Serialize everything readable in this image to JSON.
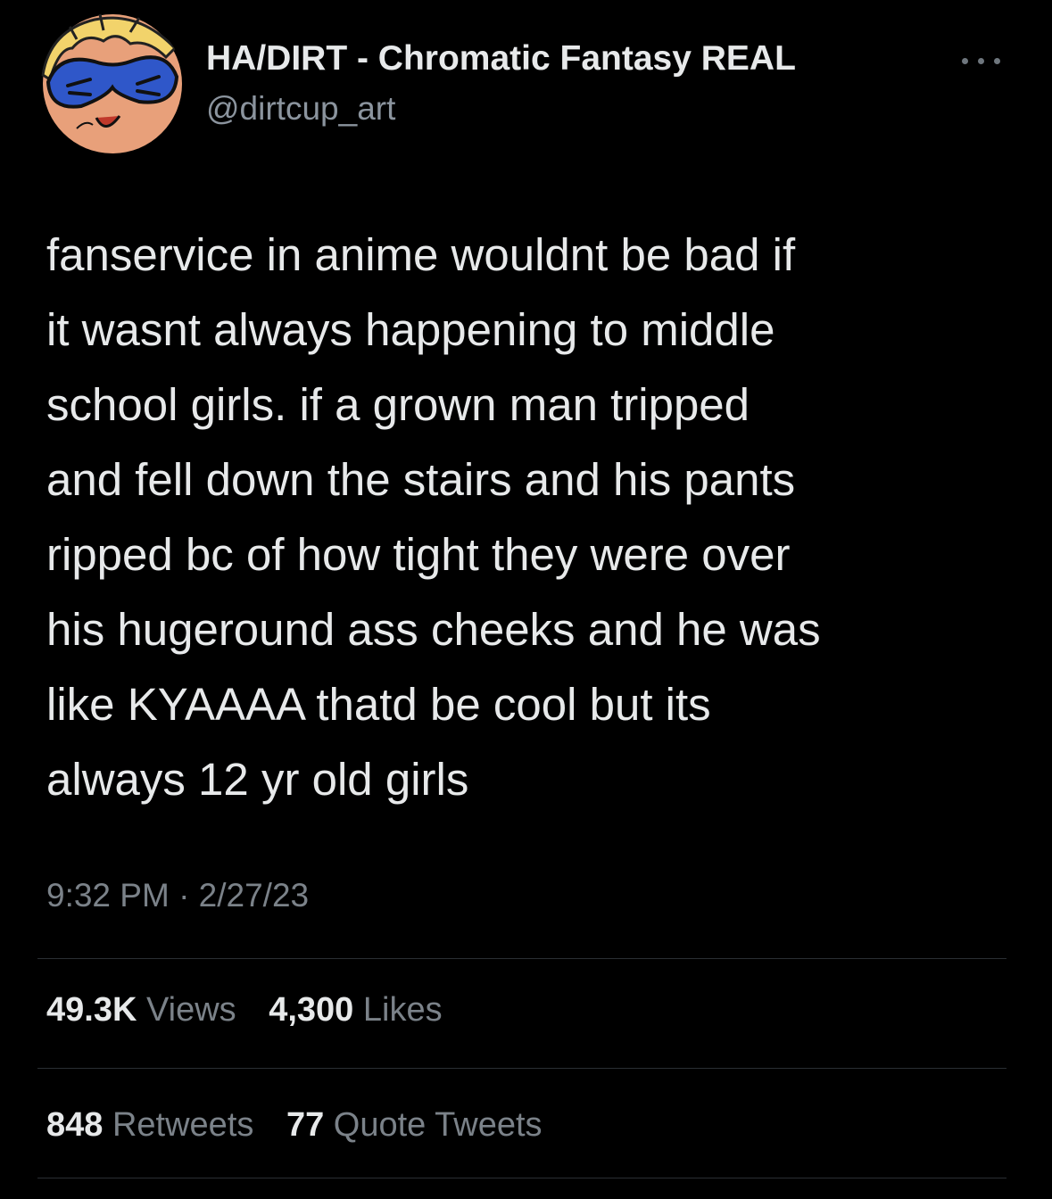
{
  "user": {
    "display_name": "HA/DIRT - Chromatic Fantasy REAL",
    "handle": "@dirtcup_art",
    "avatar_icon": "cartoon-face-avatar"
  },
  "menu": {
    "icon": "more-horizontal-icon"
  },
  "tweet": {
    "text": "fanservice in anime wouldnt be bad if\nit wasnt always happening to middle\nschool girls. if a grown man tripped\nand fell down the stairs and his pants\nripped bc of how tight they were over\nhis hugeround ass cheeks and he was\nlike KYAAAA thatd be cool but its\nalways 12 yr old girls",
    "timestamp": "9:32 PM · 2/27/23"
  },
  "stats": {
    "views": {
      "count": "49.3K",
      "label": "Views"
    },
    "likes": {
      "count": "4,300",
      "label": "Likes"
    },
    "retweets": {
      "count": "848",
      "label": "Retweets"
    },
    "quotes": {
      "count": "77",
      "label": "Quote Tweets"
    }
  },
  "colors": {
    "background": "#000000",
    "primary_text": "#e7e9ea",
    "secondary_text": "#7b8289",
    "divider": "#2a2e33"
  }
}
